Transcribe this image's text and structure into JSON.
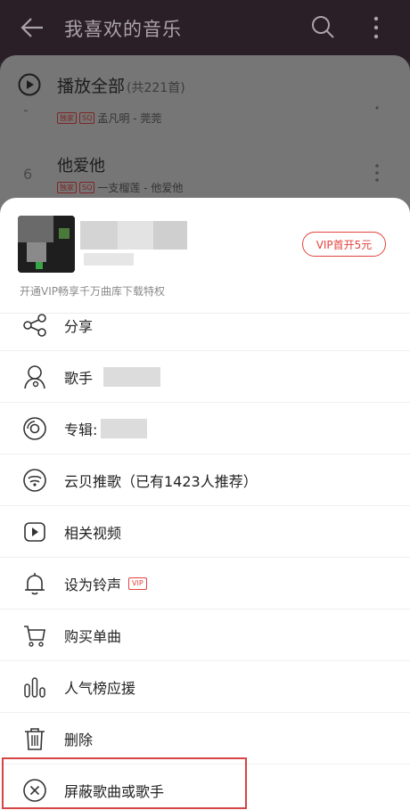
{
  "header": {
    "title": "我喜欢的音乐"
  },
  "play_all": {
    "label": "播放全部",
    "count": "(共221首)"
  },
  "tracks": [
    {
      "num": "-",
      "title": "",
      "tag1": "独家",
      "tag2": "SQ",
      "artist": "孟凡明 - 莞莞"
    },
    {
      "num": "6",
      "title": "他爱他",
      "tag1": "独家",
      "tag2": "SQ",
      "artist": "一支榴莲 - 他爱他"
    }
  ],
  "sheet": {
    "vip_button": "VIP首开5元",
    "vip_note": "开通VIP畅享千万曲库下载特权"
  },
  "menu": [
    {
      "label": "分享",
      "icon": "share-icon"
    },
    {
      "label": "歌手",
      "icon": "singer-icon"
    },
    {
      "label": "专辑:",
      "icon": "album-icon"
    },
    {
      "label": "云贝推歌（已有1423人推荐）",
      "icon": "cloud-recommend-icon"
    },
    {
      "label": "相关视频",
      "icon": "video-icon"
    },
    {
      "label": "设为铃声",
      "icon": "bell-icon",
      "badge": "VIP"
    },
    {
      "label": "购买单曲",
      "icon": "cart-icon"
    },
    {
      "label": "人气榜应援",
      "icon": "chart-bars-icon"
    },
    {
      "label": "删除",
      "icon": "trash-icon"
    },
    {
      "label": "屏蔽歌曲或歌手",
      "icon": "block-icon"
    }
  ],
  "colors": {
    "accent": "#e2433e",
    "highlight": "#d64545"
  }
}
